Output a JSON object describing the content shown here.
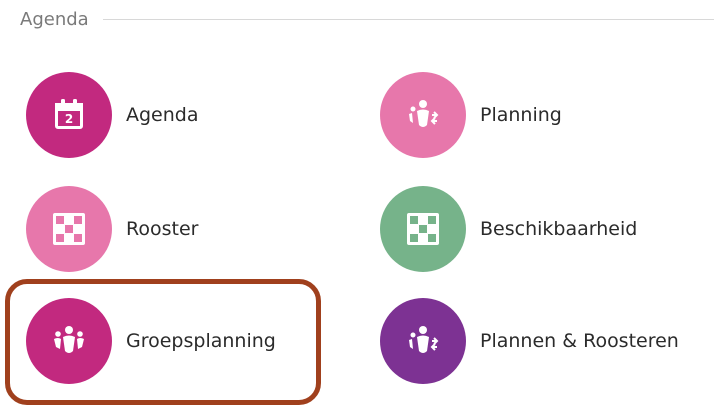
{
  "section": {
    "title": "Agenda"
  },
  "colors": {
    "magenta": "#c2297f",
    "pink": "#e777ab",
    "green": "#76b38a",
    "purple": "#7d3293",
    "highlight": "#a0401d"
  },
  "tiles": [
    {
      "label": "Agenda",
      "icon": "calendar-icon",
      "color": "#c2297f",
      "calendar_day": "2"
    },
    {
      "label": "Planning",
      "icon": "people-planning-icon",
      "color": "#e777ab"
    },
    {
      "label": "Rooster",
      "icon": "grid-schedule-icon",
      "color": "#e777ab"
    },
    {
      "label": "Beschikbaarheid",
      "icon": "grid-schedule-icon",
      "color": "#76b38a"
    },
    {
      "label": "Groepsplanning",
      "icon": "group-icon",
      "color": "#c2297f"
    },
    {
      "label": "Plannen & Roosteren",
      "icon": "people-planning-icon",
      "color": "#7d3293"
    }
  ]
}
